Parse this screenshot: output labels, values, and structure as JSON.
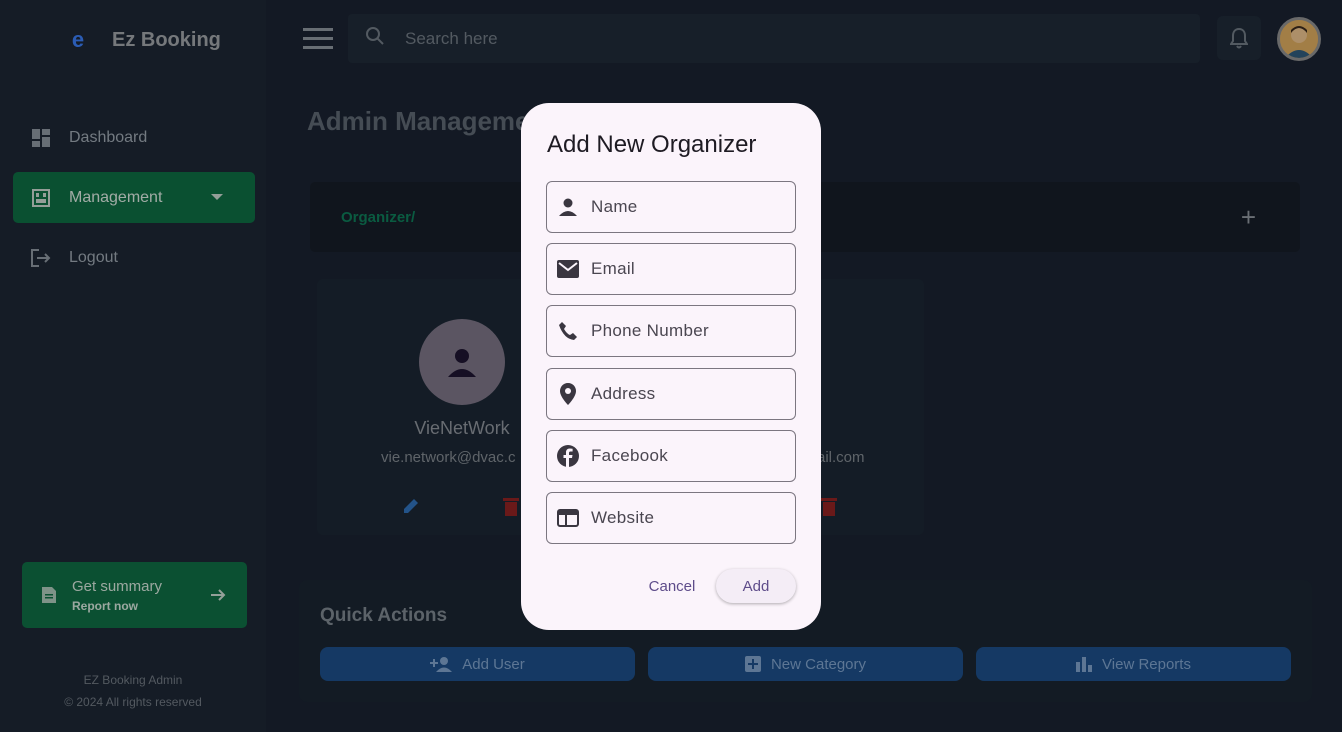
{
  "app": {
    "name": "Ez Booking",
    "logo_glyph": "e"
  },
  "sidebar": {
    "items": [
      {
        "label": "Dashboard",
        "icon": "dashboard-icon"
      },
      {
        "label": "Management",
        "icon": "management-icon",
        "active": true
      },
      {
        "label": "Logout",
        "icon": "logout-icon"
      }
    ],
    "summary": {
      "title": "Get summary",
      "subtitle": "Report now"
    },
    "footer": {
      "line1": "EZ Booking Admin",
      "line2": "© 2024 All rights reserved"
    }
  },
  "topbar": {
    "search_placeholder": "Search here"
  },
  "main": {
    "title": "Admin Managemen",
    "breadcrumb": "Organizer/",
    "plus_glyph": "+",
    "organizer": {
      "name": "VieNetWork",
      "email": "vie.network@dvac.c",
      "email2": "ail.com"
    },
    "quick_actions": {
      "title": "Quick Actions",
      "buttons": [
        {
          "label": "Add User",
          "icon": "add-user-icon"
        },
        {
          "label": "New Category",
          "icon": "add-box-icon"
        },
        {
          "label": "View Reports",
          "icon": "bar-chart-icon"
        }
      ]
    }
  },
  "dialog": {
    "title": "Add New Organizer",
    "fields": [
      {
        "placeholder": "Name",
        "icon": "person-icon"
      },
      {
        "placeholder": "Email",
        "icon": "email-icon"
      },
      {
        "placeholder": "Phone Number",
        "icon": "phone-icon"
      },
      {
        "placeholder": "Address",
        "icon": "location-icon"
      },
      {
        "placeholder": "Facebook",
        "icon": "facebook-icon"
      },
      {
        "placeholder": "Website",
        "icon": "web-icon"
      }
    ],
    "cancel_label": "Cancel",
    "add_label": "Add"
  },
  "colors": {
    "accent_green": "#0e6b42",
    "brand_blue": "#3a7bf0",
    "dialog_bg": "#fbf4fb",
    "danger": "#c62828",
    "link_purple": "#5e4c8a"
  }
}
